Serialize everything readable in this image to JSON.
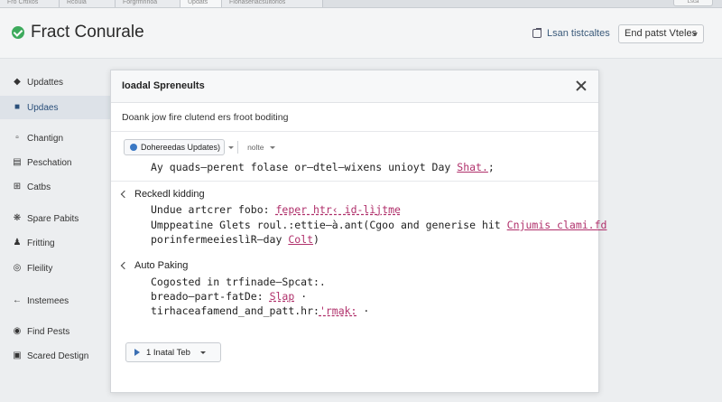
{
  "tabs": [
    "Fro Crtlxos",
    "Rcoula",
    "Forgrmnrioa",
    "Updats",
    "Flohaseriacsuitorlos"
  ],
  "tab_corner": "Lsca",
  "header": {
    "title": "Fract Conurale",
    "link_label": "Lsan tistcaltes",
    "select_value": "End patst Vteles"
  },
  "sidebar": {
    "items": [
      {
        "label": "Updattes",
        "icon": "pin-icon"
      },
      {
        "label": "Updaes",
        "icon": "flag-icon"
      },
      {
        "label": "Chantign",
        "icon": "chat-icon"
      },
      {
        "label": "Peschation",
        "icon": "document-icon"
      },
      {
        "label": "Catbs",
        "icon": "plus-icon"
      },
      {
        "label": "Spare Pabits",
        "icon": "gear-icon"
      },
      {
        "label": "Fritting",
        "icon": "person-icon"
      },
      {
        "label": "Fleility",
        "icon": "circle-icon"
      },
      {
        "label": "Instemees",
        "icon": "arrow-left-icon"
      },
      {
        "label": "Find Pests",
        "icon": "location-icon"
      },
      {
        "label": "Scared Destign",
        "icon": "lock-icon"
      }
    ],
    "active_index": 1
  },
  "modal": {
    "title": "Ioadal Spreneults",
    "description": "Doank jow fire clutend ers froot boditing",
    "pill_label": "Dohereedas Updates)",
    "filter_label": "nolte",
    "line1_text": "Ay quads–perent folase or–dtel–wixens unioyt Day",
    "line1_link": "Shat.",
    "line1_suffix": ";",
    "group1": {
      "title": "Reckedl kidding",
      "line1_text": "Undue artcrer fobo:",
      "line1_link": "feper htr‹ id-lìjtme",
      "line2_text": "Umppeatine Glets roul.:ettie–à.ant(Cgoo and generise hit",
      "line2_link": "Cnjumis clami.fd",
      "line3_text": "porinfermeeieslìR–day",
      "line3_link": "Colt",
      "line3_suffix": ")"
    },
    "group2": {
      "title": "Auto Paking",
      "line1_text": "Cogosted in trfinade–Spcat:.",
      "line2_text": "breado–part-fatDe:",
      "line2_link": "Slap",
      "line2_suffix": "·",
      "line3_text": "tirhaceafamend_and_patt.hr:",
      "line3_link": "'rmak:",
      "line3_suffix": "·"
    },
    "bottom_button": "1 Inatal Teb"
  },
  "colors": {
    "accent_green": "#3daa5c",
    "link": "#b0306b",
    "active_sidebar": "#dde2e8",
    "info_blue": "#3b78c4"
  }
}
